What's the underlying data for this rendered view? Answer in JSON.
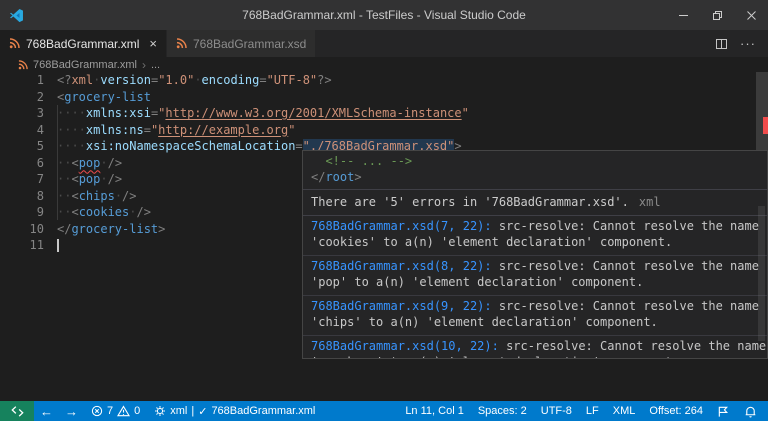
{
  "window": {
    "title": "768BadGrammar.xml - TestFiles - Visual Studio Code"
  },
  "tabs": [
    {
      "label": "768BadGrammar.xml",
      "active": true,
      "close": "×"
    },
    {
      "label": "768BadGrammar.xsd",
      "active": false
    }
  ],
  "tab_actions": {
    "more": "···"
  },
  "breadcrumb": {
    "file": "768BadGrammar.xml",
    "separator": "›",
    "ellipsis": "..."
  },
  "editor": {
    "lines": [
      {
        "num": "1",
        "tokens": [
          {
            "t": "<?",
            "c": "p"
          },
          {
            "t": "xml",
            "c": "str"
          },
          {
            "t": "·",
            "c": "ws"
          },
          {
            "t": "version",
            "c": "at"
          },
          {
            "t": "=",
            "c": "p"
          },
          {
            "t": "\"1.0\"",
            "c": "str"
          },
          {
            "t": "·",
            "c": "ws"
          },
          {
            "t": "encoding",
            "c": "at"
          },
          {
            "t": "=",
            "c": "p"
          },
          {
            "t": "\"UTF-8\"",
            "c": "str"
          },
          {
            "t": "?>",
            "c": "p"
          }
        ]
      },
      {
        "num": "2",
        "tokens": [
          {
            "t": "<",
            "c": "p"
          },
          {
            "t": "grocery-list",
            "c": "tag"
          }
        ]
      },
      {
        "num": "3",
        "tokens": [
          {
            "t": "····",
            "c": "ws"
          },
          {
            "t": "xmlns:xsi",
            "c": "at"
          },
          {
            "t": "=",
            "c": "p"
          },
          {
            "t": "\"",
            "c": "str"
          },
          {
            "t": "http://www.w3.org/2001/XMLSchema-instance",
            "c": "str lnk"
          },
          {
            "t": "\"",
            "c": "str"
          }
        ]
      },
      {
        "num": "4",
        "tokens": [
          {
            "t": "····",
            "c": "ws"
          },
          {
            "t": "xmlns:ns",
            "c": "at"
          },
          {
            "t": "=",
            "c": "p"
          },
          {
            "t": "\"",
            "c": "str"
          },
          {
            "t": "http://example.org",
            "c": "str lnk"
          },
          {
            "t": "\"",
            "c": "str"
          }
        ]
      },
      {
        "num": "5",
        "tokens": [
          {
            "t": "····",
            "c": "ws"
          },
          {
            "t": "xsi:noNamespaceSchemaLocation",
            "c": "at"
          },
          {
            "t": "=",
            "c": "p"
          },
          {
            "t": "\"./768BadGrammar.xsd\"",
            "c": "str hl sq"
          },
          {
            "t": ">",
            "c": "p"
          }
        ]
      },
      {
        "num": "6",
        "tokens": [
          {
            "t": "··",
            "c": "ws"
          },
          {
            "t": "<",
            "c": "p"
          },
          {
            "t": "pop",
            "c": "tag sq"
          },
          {
            "t": "·",
            "c": "ws"
          },
          {
            "t": "/>",
            "c": "p"
          }
        ]
      },
      {
        "num": "7",
        "tokens": [
          {
            "t": "··",
            "c": "ws"
          },
          {
            "t": "<",
            "c": "p"
          },
          {
            "t": "pop",
            "c": "tag"
          },
          {
            "t": "·",
            "c": "ws"
          },
          {
            "t": "/>",
            "c": "p"
          }
        ]
      },
      {
        "num": "8",
        "tokens": [
          {
            "t": "··",
            "c": "ws"
          },
          {
            "t": "<",
            "c": "p"
          },
          {
            "t": "chips",
            "c": "tag"
          },
          {
            "t": "·",
            "c": "ws"
          },
          {
            "t": "/>",
            "c": "p"
          }
        ]
      },
      {
        "num": "9",
        "tokens": [
          {
            "t": "··",
            "c": "ws"
          },
          {
            "t": "<",
            "c": "p"
          },
          {
            "t": "cookies",
            "c": "tag"
          },
          {
            "t": "·",
            "c": "ws"
          },
          {
            "t": "/>",
            "c": "p"
          }
        ]
      },
      {
        "num": "10",
        "tokens": [
          {
            "t": "</",
            "c": "p"
          },
          {
            "t": "grocery-list",
            "c": "tag"
          },
          {
            "t": ">",
            "c": "p"
          }
        ]
      },
      {
        "num": "11",
        "cursor": true,
        "tokens": []
      }
    ]
  },
  "hover": {
    "code": [
      [
        {
          "t": "  ",
          "c": "pl"
        },
        {
          "t": "<!-- ... -->",
          "c": "cm"
        }
      ],
      [
        {
          "t": "</",
          "c": "p"
        },
        {
          "t": "root",
          "c": "tag"
        },
        {
          "t": ">",
          "c": "p"
        }
      ]
    ],
    "summary": {
      "text": "There are '5' errors in '768BadGrammar.xsd'.",
      "lang": "xml"
    },
    "errors": [
      {
        "link": "768BadGrammar.xsd(7, 22):",
        "message": "src-resolve: Cannot resolve the name 'cookies' to a(n) 'element declaration' component."
      },
      {
        "link": "768BadGrammar.xsd(8, 22):",
        "message": "src-resolve: Cannot resolve the name 'pop' to a(n) 'element declaration' component."
      },
      {
        "link": "768BadGrammar.xsd(9, 22):",
        "message": "src-resolve: Cannot resolve the name 'chips' to a(n) 'element declaration' component."
      },
      {
        "link": "768BadGrammar.xsd(10, 22):",
        "message": "src-resolve: Cannot resolve the name 'crackers' to a(n) 'element declaration' component."
      }
    ]
  },
  "statusbar": {
    "back": "←",
    "forward": "→",
    "errors": "7",
    "warnings": "0",
    "xml_status": {
      "lang": "xml",
      "divider": "|",
      "check": "✓",
      "file": "768BadGrammar.xml"
    },
    "right": [
      "Ln 11, Col 1",
      "Spaces: 2",
      "UTF-8",
      "LF",
      "XML",
      "Offset: 264"
    ]
  },
  "colors": {
    "accent": "#007acc",
    "remote": "#16825d",
    "err": "#f14c4c",
    "link": "#3794ff",
    "tag": "#569cd6",
    "attr": "#9cdcfe",
    "str": "#ce9178",
    "cm": "#6a9955",
    "punct": "#808080",
    "lnum": "#858585",
    "bg_editor": "#1e1e1e",
    "bg_titlebar": "#323233",
    "bg_tabbar": "#252526",
    "bg_tab_inactive": "#2d2d2d",
    "hover_bg": "#252526",
    "hover_border": "#454545",
    "icon_orange": "#e8824a"
  }
}
